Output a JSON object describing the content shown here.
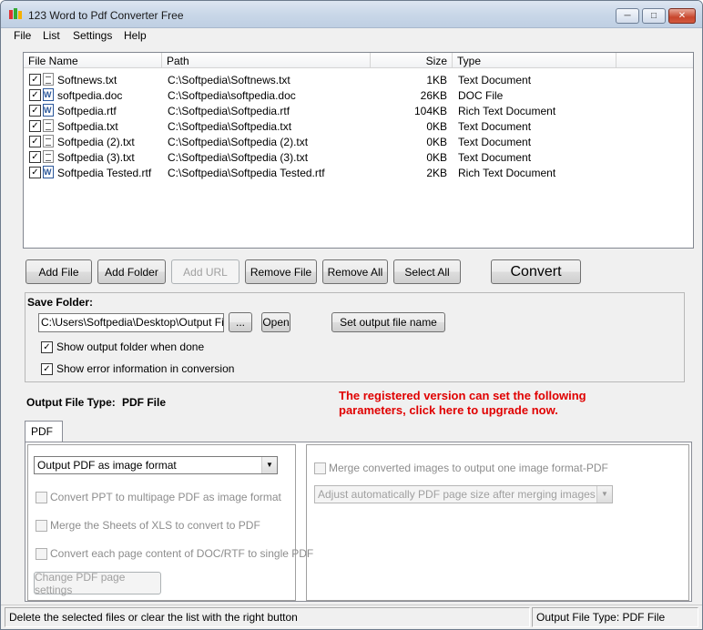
{
  "window": {
    "title": "123 Word to Pdf Converter Free",
    "icons": [
      "app-icon",
      "minimize-icon",
      "maximize-icon",
      "close-icon"
    ]
  },
  "menu": [
    "File",
    "List",
    "Settings",
    "Help"
  ],
  "file_list": {
    "columns": [
      "File Name",
      "Path",
      "Size",
      "Type"
    ],
    "rows": [
      {
        "checked": true,
        "icon": "text-file-icon",
        "name": "Softnews.txt",
        "path": "C:\\Softpedia\\Softnews.txt",
        "size": "1KB",
        "type": "Text Document"
      },
      {
        "checked": true,
        "icon": "word-document-icon",
        "name": "softpedia.doc",
        "path": "C:\\Softpedia\\softpedia.doc",
        "size": "26KB",
        "type": "DOC File"
      },
      {
        "checked": true,
        "icon": "word-document-icon",
        "name": "Softpedia.rtf",
        "path": "C:\\Softpedia\\Softpedia.rtf",
        "size": "104KB",
        "type": "Rich Text Document"
      },
      {
        "checked": true,
        "icon": "text-file-icon",
        "name": "Softpedia.txt",
        "path": "C:\\Softpedia\\Softpedia.txt",
        "size": "0KB",
        "type": "Text Document"
      },
      {
        "checked": true,
        "icon": "text-file-icon",
        "name": "Softpedia (2).txt",
        "path": "C:\\Softpedia\\Softpedia (2).txt",
        "size": "0KB",
        "type": "Text Document"
      },
      {
        "checked": true,
        "icon": "text-file-icon",
        "name": "Softpedia (3).txt",
        "path": "C:\\Softpedia\\Softpedia (3).txt",
        "size": "0KB",
        "type": "Text Document"
      },
      {
        "checked": true,
        "icon": "word-document-icon",
        "name": "Softpedia Tested.rtf",
        "path": "C:\\Softpedia\\Softpedia Tested.rtf",
        "size": "2KB",
        "type": "Rich Text Document"
      }
    ]
  },
  "toolbar": {
    "add_file": "Add File",
    "add_folder": "Add Folder",
    "add_url": "Add URL",
    "remove_file": "Remove File",
    "remove_all": "Remove All",
    "select_all": "Select All",
    "convert": "Convert"
  },
  "save_folder": {
    "label": "Save Folder:",
    "path": "C:\\Users\\Softpedia\\Desktop\\Output Files",
    "browse": "...",
    "open": "Open",
    "set_output_name": "Set output file name",
    "show_output_folder": "Show output folder when done",
    "show_error_info": "Show error information in conversion"
  },
  "output_type": {
    "label": "Output File Type:",
    "value": "PDF File"
  },
  "upgrade_notice": "The registered version can set the following parameters, click here to upgrade now.",
  "pdf_tab": {
    "tab_label": "PDF",
    "format_select": "Output PDF as image format",
    "convert_ppt": "Convert PPT to multipage PDF as image format",
    "merge_xls": "Merge the Sheets of XLS to convert to PDF",
    "convert_each_page": "Convert each page content of DOC/RTF to single PDF",
    "change_page_settings": "Change PDF page settings",
    "merge_images": "Merge converted images to output one image format-PDF",
    "adjust_page_size": "Adjust automatically PDF page size after merging images to PDF"
  },
  "status": {
    "hint": "Delete the selected files or clear the list with the right button",
    "output_type_label": "Output File Type:",
    "output_type_value": "PDF File"
  }
}
